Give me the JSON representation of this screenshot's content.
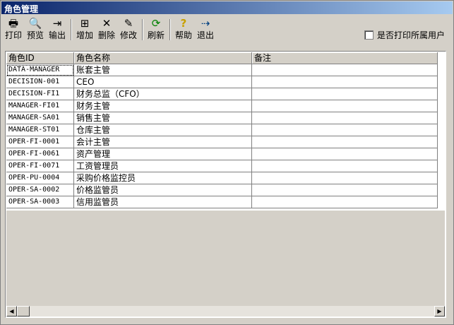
{
  "window": {
    "title": "角色管理"
  },
  "toolbar": {
    "print": "打印",
    "preview": "预览",
    "export": "输出",
    "add": "增加",
    "delete": "删除",
    "edit": "修改",
    "refresh": "刷新",
    "help": "帮助",
    "exit": "退出"
  },
  "options": {
    "print_all_users": "是否打印所属用户"
  },
  "table": {
    "headers": [
      "角色ID",
      "角色名称",
      "备注"
    ],
    "rows": [
      {
        "id": "DATA-MANAGER",
        "name": "账套主管",
        "note": ""
      },
      {
        "id": "DECISION-001",
        "name": "CEO",
        "note": ""
      },
      {
        "id": "DECISION-FI1",
        "name": "财务总监（CFO）",
        "note": ""
      },
      {
        "id": "MANAGER-FI01",
        "name": "财务主管",
        "note": ""
      },
      {
        "id": "MANAGER-SA01",
        "name": "销售主管",
        "note": ""
      },
      {
        "id": "MANAGER-ST01",
        "name": "仓库主管",
        "note": ""
      },
      {
        "id": "OPER-FI-0001",
        "name": "会计主管",
        "note": ""
      },
      {
        "id": "OPER-FI-0061",
        "name": "资产管理",
        "note": ""
      },
      {
        "id": "OPER-FI-0071",
        "name": "工资管理员",
        "note": ""
      },
      {
        "id": "OPER-PU-0004",
        "name": "采购价格监控员",
        "note": ""
      },
      {
        "id": "OPER-SA-0002",
        "name": "价格监管员",
        "note": ""
      },
      {
        "id": "OPER-SA-0003",
        "name": "信用监管员",
        "note": ""
      }
    ]
  },
  "icons": {
    "print": "printer-icon",
    "preview": "preview-icon",
    "export": "export-icon",
    "add": "add-icon",
    "delete": "delete-icon",
    "edit": "edit-icon",
    "refresh": "refresh-icon",
    "help": "help-icon",
    "exit": "exit-icon"
  }
}
